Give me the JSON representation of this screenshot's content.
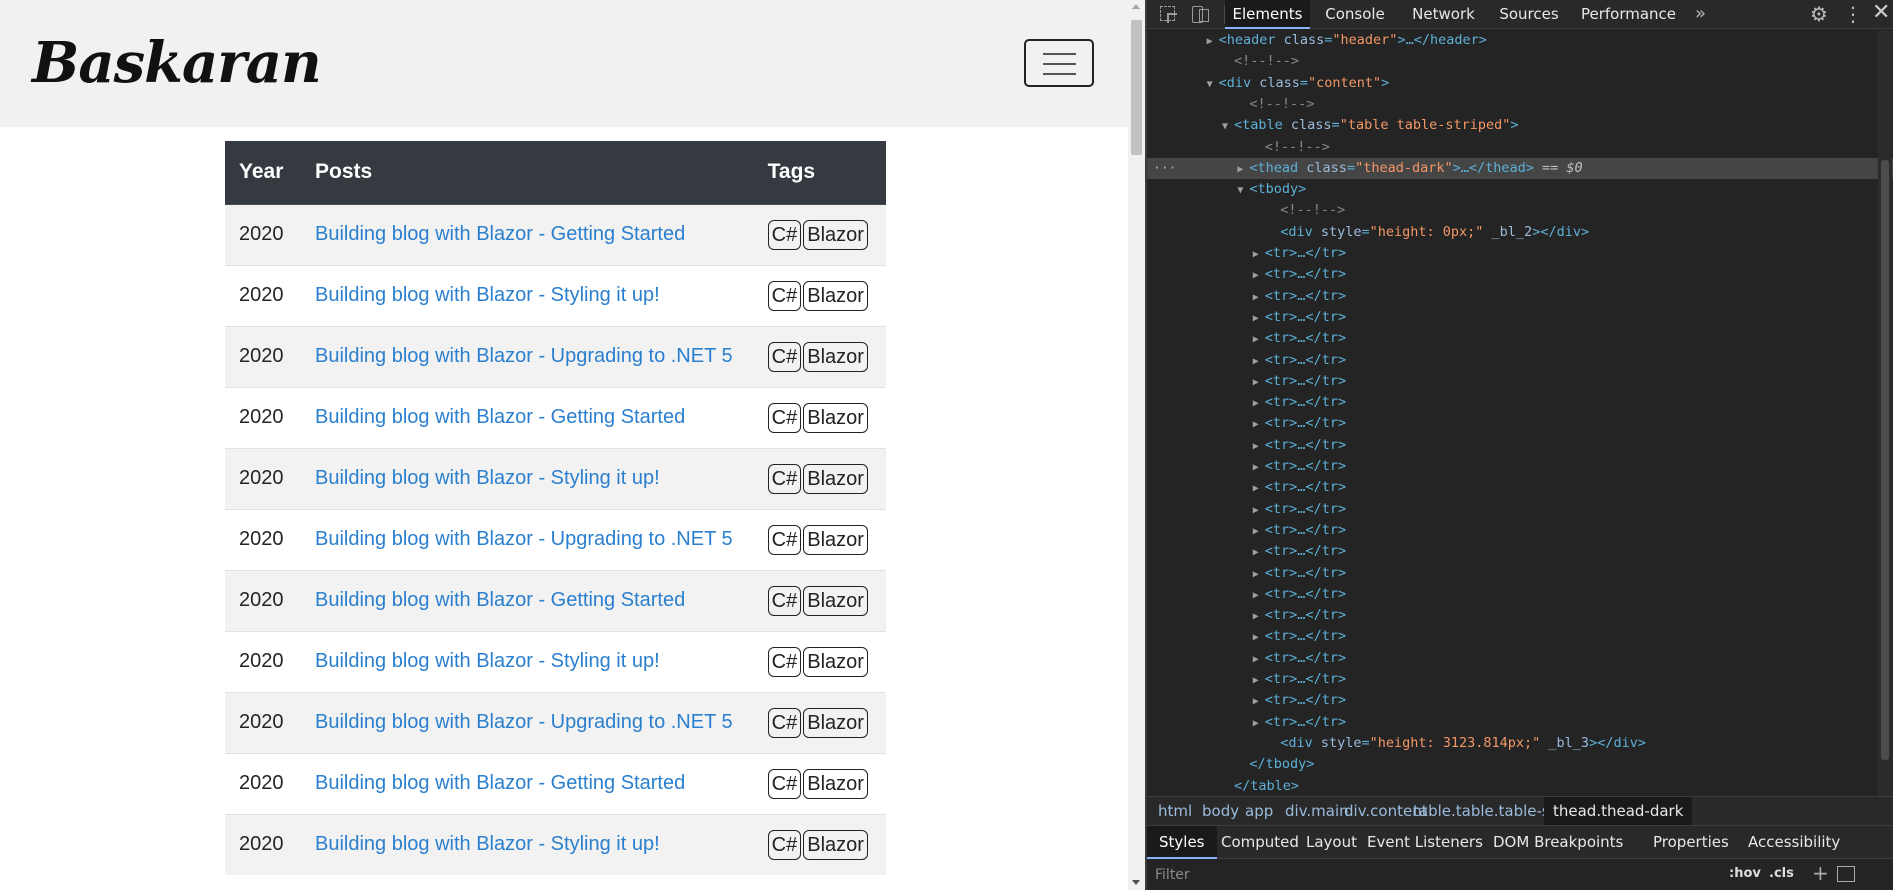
{
  "site": {
    "logo_text": "Baskaran",
    "menu_toggle_label": "menu"
  },
  "table": {
    "headers": [
      "Year",
      "Posts",
      "Tags"
    ],
    "rows": [
      {
        "year": "2020",
        "post": "Building blog with Blazor - Getting Started",
        "tags": [
          "C#",
          "Blazor"
        ]
      },
      {
        "year": "2020",
        "post": "Building blog with Blazor - Styling it up!",
        "tags": [
          "C#",
          "Blazor"
        ]
      },
      {
        "year": "2020",
        "post": "Building blog with Blazor - Upgrading to .NET 5",
        "tags": [
          "C#",
          "Blazor"
        ]
      },
      {
        "year": "2020",
        "post": "Building blog with Blazor - Getting Started",
        "tags": [
          "C#",
          "Blazor"
        ]
      },
      {
        "year": "2020",
        "post": "Building blog with Blazor - Styling it up!",
        "tags": [
          "C#",
          "Blazor"
        ]
      },
      {
        "year": "2020",
        "post": "Building blog with Blazor - Upgrading to .NET 5",
        "tags": [
          "C#",
          "Blazor"
        ]
      },
      {
        "year": "2020",
        "post": "Building blog with Blazor - Getting Started",
        "tags": [
          "C#",
          "Blazor"
        ]
      },
      {
        "year": "2020",
        "post": "Building blog with Blazor - Styling it up!",
        "tags": [
          "C#",
          "Blazor"
        ]
      },
      {
        "year": "2020",
        "post": "Building blog with Blazor - Upgrading to .NET 5",
        "tags": [
          "C#",
          "Blazor"
        ]
      },
      {
        "year": "2020",
        "post": "Building blog with Blazor - Getting Started",
        "tags": [
          "C#",
          "Blazor"
        ]
      },
      {
        "year": "2020",
        "post": "Building blog with Blazor - Styling it up!",
        "tags": [
          "C#",
          "Blazor"
        ]
      }
    ]
  },
  "devtools": {
    "tabs": [
      "Elements",
      "Console",
      "Network",
      "Sources",
      "Performance"
    ],
    "active_tab": "Elements",
    "more_tabs": "»",
    "dom_lines": [
      {
        "indent": 4,
        "tri": "right",
        "parts": [
          [
            "tag-name",
            "<header "
          ],
          [
            "attr-name",
            "class"
          ],
          [
            "tag-name",
            "="
          ],
          [
            "attr-val",
            "\"header\""
          ],
          [
            "tag-name",
            ">…</header>"
          ]
        ]
      },
      {
        "indent": 5,
        "tri": "",
        "parts": [
          [
            "comment",
            "<!--!-->"
          ]
        ]
      },
      {
        "indent": 4,
        "tri": "down",
        "parts": [
          [
            "tag-name",
            "<div "
          ],
          [
            "attr-name",
            "class"
          ],
          [
            "tag-name",
            "="
          ],
          [
            "attr-val",
            "\"content\""
          ],
          [
            "tag-name",
            ">"
          ]
        ]
      },
      {
        "indent": 6,
        "tri": "",
        "parts": [
          [
            "comment",
            "<!--!-->"
          ]
        ]
      },
      {
        "indent": 5,
        "tri": "down",
        "parts": [
          [
            "tag-name",
            "<table "
          ],
          [
            "attr-name",
            "class"
          ],
          [
            "tag-name",
            "="
          ],
          [
            "attr-val",
            "\"table table-striped\""
          ],
          [
            "tag-name",
            ">"
          ]
        ]
      },
      {
        "indent": 7,
        "tri": "",
        "parts": [
          [
            "comment",
            "<!--!-->"
          ]
        ]
      },
      {
        "indent": 6,
        "tri": "right",
        "selected": true,
        "parts": [
          [
            "tag-name",
            "<thead "
          ],
          [
            "attr-name",
            "class"
          ],
          [
            "tag-name",
            "="
          ],
          [
            "attr-val",
            "\"thead-dark\""
          ],
          [
            "tag-name",
            ">…</thead>"
          ],
          [
            "dollar",
            " == $0"
          ]
        ]
      },
      {
        "indent": 6,
        "tri": "down",
        "parts": [
          [
            "tag-name",
            "<tbody>"
          ]
        ]
      },
      {
        "indent": 8,
        "tri": "",
        "parts": [
          [
            "comment",
            "<!--!-->"
          ]
        ]
      },
      {
        "indent": 8,
        "tri": "",
        "parts": [
          [
            "tag-name",
            "<div "
          ],
          [
            "attr-name",
            "style"
          ],
          [
            "tag-name",
            "="
          ],
          [
            "attr-val",
            "\"height: 0px;\""
          ],
          [
            "attr-name",
            " _bl_2"
          ],
          [
            "tag-name",
            "></div>"
          ]
        ]
      },
      {
        "indent": 7,
        "tri": "right",
        "parts": [
          [
            "tag-name",
            "<tr>…</tr>"
          ]
        ]
      },
      {
        "indent": 7,
        "tri": "right",
        "parts": [
          [
            "tag-name",
            "<tr>…</tr>"
          ]
        ]
      },
      {
        "indent": 7,
        "tri": "right",
        "parts": [
          [
            "tag-name",
            "<tr>…</tr>"
          ]
        ]
      },
      {
        "indent": 7,
        "tri": "right",
        "parts": [
          [
            "tag-name",
            "<tr>…</tr>"
          ]
        ]
      },
      {
        "indent": 7,
        "tri": "right",
        "parts": [
          [
            "tag-name",
            "<tr>…</tr>"
          ]
        ]
      },
      {
        "indent": 7,
        "tri": "right",
        "parts": [
          [
            "tag-name",
            "<tr>…</tr>"
          ]
        ]
      },
      {
        "indent": 7,
        "tri": "right",
        "parts": [
          [
            "tag-name",
            "<tr>…</tr>"
          ]
        ]
      },
      {
        "indent": 7,
        "tri": "right",
        "parts": [
          [
            "tag-name",
            "<tr>…</tr>"
          ]
        ]
      },
      {
        "indent": 7,
        "tri": "right",
        "parts": [
          [
            "tag-name",
            "<tr>…</tr>"
          ]
        ]
      },
      {
        "indent": 7,
        "tri": "right",
        "parts": [
          [
            "tag-name",
            "<tr>…</tr>"
          ]
        ]
      },
      {
        "indent": 7,
        "tri": "right",
        "parts": [
          [
            "tag-name",
            "<tr>…</tr>"
          ]
        ]
      },
      {
        "indent": 7,
        "tri": "right",
        "parts": [
          [
            "tag-name",
            "<tr>…</tr>"
          ]
        ]
      },
      {
        "indent": 7,
        "tri": "right",
        "parts": [
          [
            "tag-name",
            "<tr>…</tr>"
          ]
        ]
      },
      {
        "indent": 7,
        "tri": "right",
        "parts": [
          [
            "tag-name",
            "<tr>…</tr>"
          ]
        ]
      },
      {
        "indent": 7,
        "tri": "right",
        "parts": [
          [
            "tag-name",
            "<tr>…</tr>"
          ]
        ]
      },
      {
        "indent": 7,
        "tri": "right",
        "parts": [
          [
            "tag-name",
            "<tr>…</tr>"
          ]
        ]
      },
      {
        "indent": 7,
        "tri": "right",
        "parts": [
          [
            "tag-name",
            "<tr>…</tr>"
          ]
        ]
      },
      {
        "indent": 7,
        "tri": "right",
        "parts": [
          [
            "tag-name",
            "<tr>…</tr>"
          ]
        ]
      },
      {
        "indent": 7,
        "tri": "right",
        "parts": [
          [
            "tag-name",
            "<tr>…</tr>"
          ]
        ]
      },
      {
        "indent": 7,
        "tri": "right",
        "parts": [
          [
            "tag-name",
            "<tr>…</tr>"
          ]
        ]
      },
      {
        "indent": 7,
        "tri": "right",
        "parts": [
          [
            "tag-name",
            "<tr>…</tr>"
          ]
        ]
      },
      {
        "indent": 7,
        "tri": "right",
        "parts": [
          [
            "tag-name",
            "<tr>…</tr>"
          ]
        ]
      },
      {
        "indent": 7,
        "tri": "right",
        "parts": [
          [
            "tag-name",
            "<tr>…</tr>"
          ]
        ]
      },
      {
        "indent": 8,
        "tri": "",
        "parts": [
          [
            "tag-name",
            "<div "
          ],
          [
            "attr-name",
            "style"
          ],
          [
            "tag-name",
            "="
          ],
          [
            "attr-val",
            "\"height: 3123.814px;\""
          ],
          [
            "attr-name",
            " _bl_3"
          ],
          [
            "tag-name",
            "></div>"
          ]
        ]
      },
      {
        "indent": 6,
        "tri": "",
        "parts": [
          [
            "tag-name",
            "</tbody>"
          ]
        ]
      },
      {
        "indent": 5,
        "tri": "",
        "parts": [
          [
            "tag-name",
            "</table>"
          ]
        ]
      }
    ],
    "selected_dots": "···",
    "breadcrumbs": [
      "html",
      "body",
      "app",
      "div.main",
      "div.content",
      "table.table.table-striped",
      "thead.thead-dark"
    ],
    "styles_tabs": [
      "Styles",
      "Computed",
      "Layout",
      "Event Listeners",
      "DOM Breakpoints",
      "Properties",
      "Accessibility"
    ],
    "active_styles_tab": "Styles",
    "filter_placeholder": "Filter",
    "hov_label": ":hov",
    "cls_label": ".cls",
    "colors": {
      "selection": "#454545",
      "tag": "#5db0d7",
      "attr": "#9bbbdc",
      "value": "#f29766"
    }
  }
}
